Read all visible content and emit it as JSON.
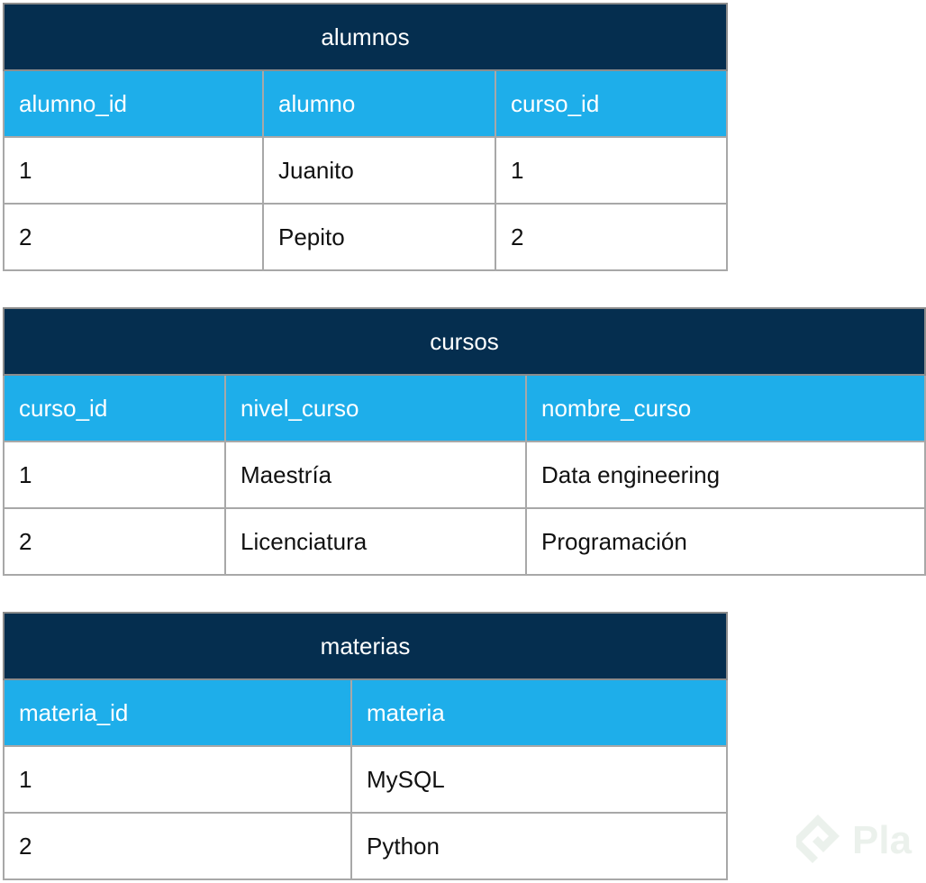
{
  "tables": {
    "alumnos": {
      "title": "alumnos",
      "headers": [
        "alumno_id",
        "alumno",
        "curso_id"
      ],
      "rows": [
        [
          "1",
          "Juanito",
          "1"
        ],
        [
          "2",
          "Pepito",
          "2"
        ]
      ]
    },
    "cursos": {
      "title": "cursos",
      "headers": [
        "curso_id",
        "nivel_curso",
        "nombre_curso"
      ],
      "rows": [
        [
          "1",
          "Maestría",
          "Data engineering"
        ],
        [
          "2",
          "Licenciatura",
          "Programación"
        ]
      ]
    },
    "materias": {
      "title": "materias",
      "headers": [
        "materia_id",
        "materia"
      ],
      "rows": [
        [
          "1",
          "MySQL"
        ],
        [
          "2",
          "Python"
        ]
      ]
    }
  },
  "colors": {
    "title_bg": "#052e4f",
    "header_bg": "#1eaeea",
    "border": "#a8a8a8"
  },
  "watermark": {
    "text": "Pla",
    "icon": "platzi-logo-icon"
  }
}
